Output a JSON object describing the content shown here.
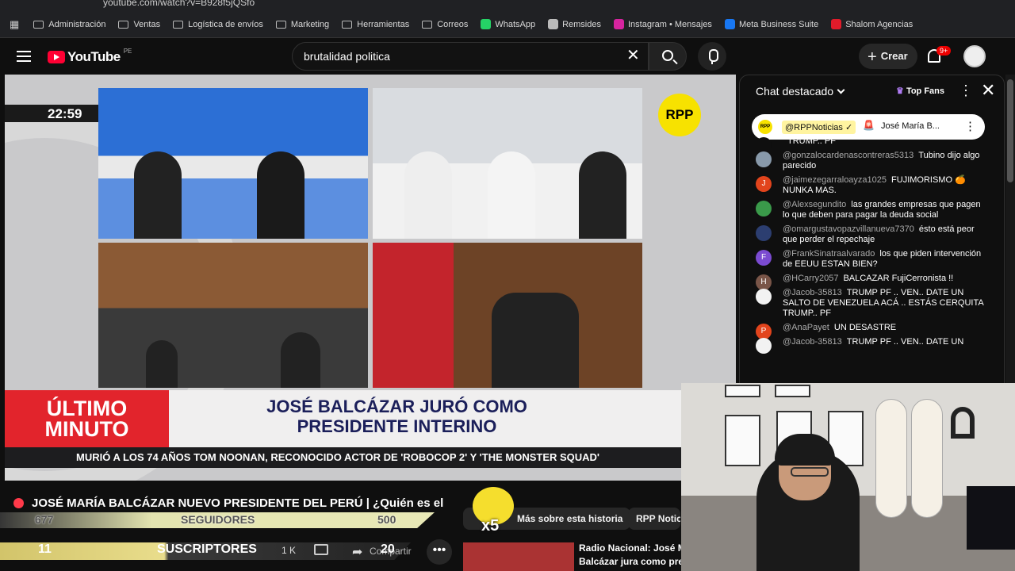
{
  "browser": {
    "url": "youtube.com/watch?v=B928f5jQSfo",
    "bookmarks": [
      {
        "label": "Administración",
        "icon": "folder-icon"
      },
      {
        "label": "Ventas",
        "icon": "folder-icon"
      },
      {
        "label": "Logística de envíos",
        "icon": "folder-icon"
      },
      {
        "label": "Marketing",
        "icon": "folder-icon"
      },
      {
        "label": "Herramientas",
        "icon": "folder-icon"
      },
      {
        "label": "Correos",
        "icon": "folder-icon"
      },
      {
        "label": "WhatsApp",
        "icon": "whatsapp-icon",
        "color": "#25d366"
      },
      {
        "label": "Remsides",
        "icon": "remsides-icon",
        "color": "#bbbbbb"
      },
      {
        "label": "Instagram • Mensajes",
        "icon": "instagram-icon",
        "color": "#d6249f"
      },
      {
        "label": "Meta Business Suite",
        "icon": "meta-icon",
        "color": "#1877f2"
      },
      {
        "label": "Shalom Agencias",
        "icon": "shalom-icon",
        "color": "#e11b2a"
      }
    ]
  },
  "header": {
    "logo": "YouTube",
    "region": "PE",
    "search_value": "brutalidad politica",
    "create_label": "Crear",
    "notif_count": "9+"
  },
  "video": {
    "clock": "22:59",
    "channel_logo": "RPP",
    "breaking_label_1": "ÚLTIMO",
    "breaking_label_2": "MINUTO",
    "headline_1": "JOSÉ BALCÁZAR JURÓ COMO",
    "headline_2": "PRESIDENTE INTERINO",
    "ticker": "MURIÓ A LOS 74 AÑOS TOM NOONAN, RECONOCIDO ACTOR DE 'ROBOCOP 2' Y 'THE MONSTER SQUAD'"
  },
  "below": {
    "title": "JOSÉ MARÍA BALCÁZAR NUEVO PRESIDENTE DEL PERÚ | ¿Quién es el",
    "followers_left": "677",
    "followers_label": "SEGUIDORES",
    "followers_goal": "500",
    "subs_left": "11",
    "subs_label": "SUSCRIPTORES",
    "subs_goal": "20",
    "likes": "1 K",
    "share_label": "Compartir",
    "more_label": "•••",
    "multiplier": "x5",
    "chips": [
      "Más sobre esta historia",
      "RPP Notici"
    ],
    "related_title_1": "Radio Nacional: José Ma",
    "related_title_2": "Balcázar jura como presi"
  },
  "chat": {
    "header": "Chat destacado",
    "top_fans": "Top Fans",
    "pinned_user": "@RPPNoticias ✓",
    "pinned_text": "José María B...",
    "messages": [
      {
        "user": "",
        "text": "TRUMP.. PF",
        "avatar": "",
        "color": "#0f0f0f"
      },
      {
        "user": "@gonzalocardenascontreras5313",
        "text": "Tubino dijo algo parecido",
        "avatar": "",
        "color": "#8899aa"
      },
      {
        "user": "@jaimezegarraloayza1025",
        "text": "FUJIMORISMO 🍊 NUNKA MAS.",
        "avatar": "J",
        "color": "#e2441c"
      },
      {
        "user": "@Alexsegundito",
        "text": "las grandes empresas que pagen lo que deben para pagar la deuda social",
        "avatar": "",
        "color": "#3a9a4a"
      },
      {
        "user": "@omargustavopazvillanueva7370",
        "text": "ésto está peor que perder el repechaje",
        "avatar": "",
        "color": "#2c3e70"
      },
      {
        "user": "@FrankSinatraalvarado",
        "text": "los que piden intervención de EEUU ESTAN BIEN?",
        "avatar": "F",
        "color": "#7b4bd1"
      },
      {
        "user": "@HCarry2057",
        "text": "BALCAZAR FujiCerronista !!",
        "avatar": "H",
        "color": "#795548"
      },
      {
        "user": "@Jacob-35813",
        "text": "TRUMP PF .. VEN.. DATE UN SALTO DE VENEZUELA ACÁ .. ESTÁS CERQUITA TRUMP.. PF",
        "avatar": "",
        "color": "#f2f2f2"
      },
      {
        "user": "@AnaPayet",
        "text": "UN DESASTRE",
        "avatar": "P",
        "color": "#e2441c"
      },
      {
        "user": "@Jacob-35813",
        "text": "TRUMP PF .. VEN.. DATE UN",
        "avatar": "",
        "color": "#f2f2f2"
      }
    ]
  }
}
